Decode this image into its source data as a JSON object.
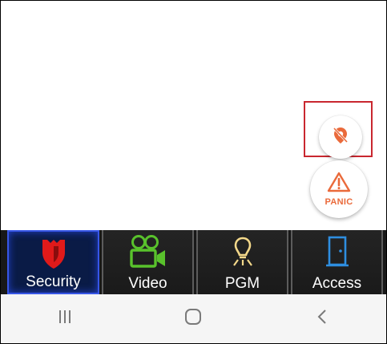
{
  "fabs": {
    "location_off_icon": "location-off-icon",
    "panic_icon": "warning-icon",
    "panic_label": "PANIC"
  },
  "tabs": [
    {
      "label": "Security",
      "icon": "shield-icon",
      "active": true
    },
    {
      "label": "Video",
      "icon": "video-camera-icon",
      "active": false
    },
    {
      "label": "PGM",
      "icon": "bulb-icon",
      "active": false
    },
    {
      "label": "Access",
      "icon": "door-icon",
      "active": false
    }
  ],
  "navbar": {
    "recents_icon": "recents-icon",
    "home_icon": "home-icon",
    "back_icon": "back-icon"
  },
  "colors": {
    "accent_orange": "#ea6a3b",
    "security_red": "#e01a1a",
    "video_green": "#59c22c",
    "pgm_yellow": "#f3d88a",
    "access_blue": "#2e8ee0",
    "highlight_red": "#c9272f"
  }
}
